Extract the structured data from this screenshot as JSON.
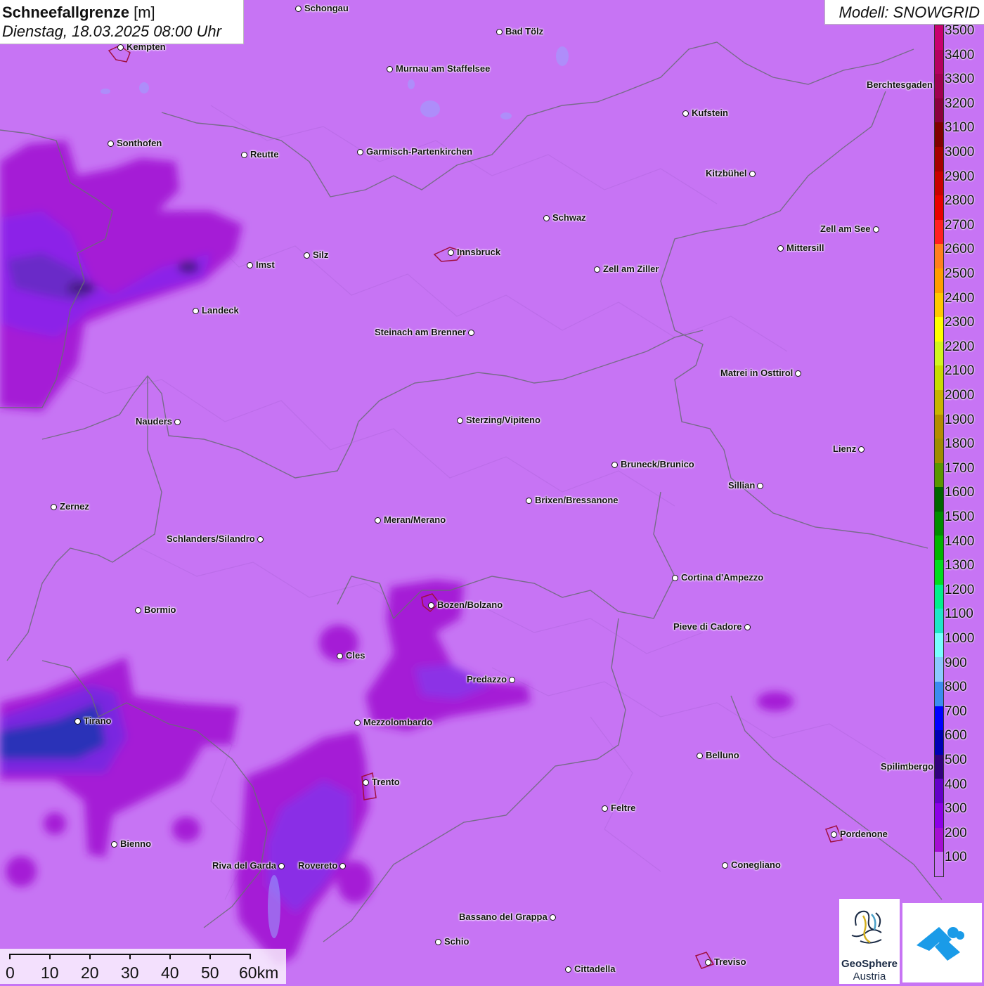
{
  "header": {
    "title": "Schneefallgrenze",
    "unit": "[m]",
    "datetime": "Dienstag, 18.03.2025 08:00 Uhr",
    "model": "Modell: SNOWGRID"
  },
  "legend": {
    "entries": [
      {
        "label": "3500",
        "color": "#c8006e"
      },
      {
        "label": "3400",
        "color": "#b4005f"
      },
      {
        "label": "3300",
        "color": "#a00050"
      },
      {
        "label": "3200",
        "color": "#8a003c"
      },
      {
        "label": "3100",
        "color": "#800000"
      },
      {
        "label": "3000",
        "color": "#a50000"
      },
      {
        "label": "2900",
        "color": "#c80000"
      },
      {
        "label": "2800",
        "color": "#e80000"
      },
      {
        "label": "2700",
        "color": "#ff2020"
      },
      {
        "label": "2600",
        "color": "#ff7f1e"
      },
      {
        "label": "2500",
        "color": "#ff9d00"
      },
      {
        "label": "2400",
        "color": "#ffc800"
      },
      {
        "label": "2300",
        "color": "#ffff00"
      },
      {
        "label": "2200",
        "color": "#d2f51e"
      },
      {
        "label": "2100",
        "color": "#c8dc00"
      },
      {
        "label": "2000",
        "color": "#c8b400"
      },
      {
        "label": "1900",
        "color": "#b48c00"
      },
      {
        "label": "1800",
        "color": "#a08c00"
      },
      {
        "label": "1700",
        "color": "#5a9600"
      },
      {
        "label": "1600",
        "color": "#006400"
      },
      {
        "label": "1500",
        "color": "#008c00"
      },
      {
        "label": "1400",
        "color": "#00b400"
      },
      {
        "label": "1300",
        "color": "#00dc1e"
      },
      {
        "label": "1200",
        "color": "#00f08c"
      },
      {
        "label": "1100",
        "color": "#1ee6c8"
      },
      {
        "label": "1000",
        "color": "#78ffff"
      },
      {
        "label": "900",
        "color": "#8cc8ff"
      },
      {
        "label": "800",
        "color": "#3c8cf0"
      },
      {
        "label": "700",
        "color": "#0000ff"
      },
      {
        "label": "600",
        "color": "#0000b4"
      },
      {
        "label": "500",
        "color": "#32007d"
      },
      {
        "label": "400",
        "color": "#6400c8"
      },
      {
        "label": "300",
        "color": "#8c00e6"
      },
      {
        "label": "200",
        "color": "#a50fd2"
      },
      {
        "label": "100",
        "color": "#c774f4"
      }
    ]
  },
  "cities": [
    {
      "name": "Schongau",
      "side": "r"
    },
    {
      "name": "Bad Tölz",
      "side": "r"
    },
    {
      "name": "Kempten",
      "side": "r"
    },
    {
      "name": "Murnau am Staffelsee",
      "side": "r"
    },
    {
      "name": "Kufstein",
      "side": "r"
    },
    {
      "name": "Berchtesgaden",
      "side": "l"
    },
    {
      "name": "Sonthofen",
      "side": "r"
    },
    {
      "name": "Reutte",
      "side": "r"
    },
    {
      "name": "Garmisch-Partenkirchen",
      "side": "r"
    },
    {
      "name": "Kitzbühel",
      "side": "l"
    },
    {
      "name": "Schwaz",
      "side": "r"
    },
    {
      "name": "Zell am See",
      "side": "l"
    },
    {
      "name": "Innsbruck",
      "side": "r"
    },
    {
      "name": "Mittersill",
      "side": "r"
    },
    {
      "name": "Silz",
      "side": "r"
    },
    {
      "name": "Imst",
      "side": "r"
    },
    {
      "name": "Zell am Ziller",
      "side": "r"
    },
    {
      "name": "Landeck",
      "side": "r"
    },
    {
      "name": "Steinach am Brenner",
      "side": "l"
    },
    {
      "name": "Matrei in Osttirol",
      "side": "l"
    },
    {
      "name": "Nauders",
      "side": "l"
    },
    {
      "name": "Sterzing/Vipiteno",
      "side": "r"
    },
    {
      "name": "Lienz",
      "side": "l"
    },
    {
      "name": "Bruneck/Brunico",
      "side": "r"
    },
    {
      "name": "Sillian",
      "side": "l"
    },
    {
      "name": "Brixen/Bressanone",
      "side": "r"
    },
    {
      "name": "Zernez",
      "side": "r"
    },
    {
      "name": "Meran/Merano",
      "side": "r"
    },
    {
      "name": "Schlanders/Silandro",
      "side": "l"
    },
    {
      "name": "Cortina d'Ampezzo",
      "side": "r"
    },
    {
      "name": "Bozen/Bolzano",
      "side": "r"
    },
    {
      "name": "Bormio",
      "side": "r"
    },
    {
      "name": "Pieve di Cadore",
      "side": "l"
    },
    {
      "name": "Cles",
      "side": "r"
    },
    {
      "name": "Predazzo",
      "side": "l"
    },
    {
      "name": "Tirano",
      "side": "r"
    },
    {
      "name": "Mezzolombardo",
      "side": "r"
    },
    {
      "name": "Belluno",
      "side": "r"
    },
    {
      "name": "Spilimbergo",
      "side": "r"
    },
    {
      "name": "Trento",
      "side": "r"
    },
    {
      "name": "Feltre",
      "side": "r"
    },
    {
      "name": "Pordenone",
      "side": "r"
    },
    {
      "name": "Bienno",
      "side": "r"
    },
    {
      "name": "Riva del Garda",
      "side": "l"
    },
    {
      "name": "Rovereto",
      "side": "l"
    },
    {
      "name": "Conegliano",
      "side": "r"
    },
    {
      "name": "Bassano del Grappa",
      "side": "l"
    },
    {
      "name": "Schio",
      "side": "r"
    },
    {
      "name": "Treviso",
      "side": "r"
    },
    {
      "name": "Cittadella",
      "side": "r"
    }
  ],
  "scale_bar": {
    "labels": [
      "0",
      "10",
      "20",
      "30",
      "40",
      "50",
      "60km"
    ]
  },
  "logos": {
    "geosphere_line1": "GeoSphere",
    "geosphere_line2": "Austria"
  }
}
